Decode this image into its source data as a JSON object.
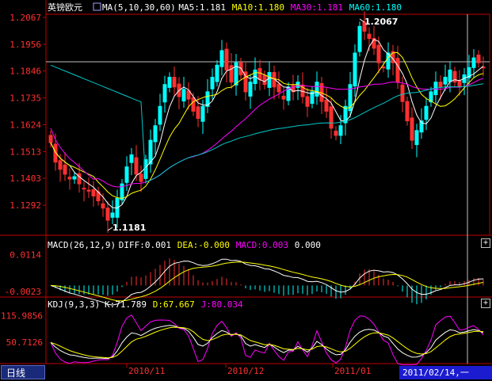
{
  "main_panel": {
    "symbol": "英镑欧元",
    "ma_label": "MA(5,10,30,60)",
    "ma_values": [
      {
        "text": "MA5:1.181",
        "color": "#ffffff"
      },
      {
        "text": "MA10:1.180",
        "color": "#ffff00"
      },
      {
        "text": "MA30:1.181",
        "color": "#ff00ff"
      },
      {
        "text": "MA60:1.180",
        "color": "#00ffff"
      }
    ],
    "y_ticks": [
      "1.2067",
      "1.1956",
      "1.1846",
      "1.1735",
      "1.1624",
      "1.1513",
      "1.1403",
      "1.1292"
    ],
    "high_label": "1.2067",
    "low_label": "1.1181"
  },
  "macd_panel": {
    "label": "MACD(26,12,9)",
    "values": [
      {
        "text": "DIFF:0.001",
        "color": "#ffffff"
      },
      {
        "text": "DEA:-0.000",
        "color": "#ffff00"
      },
      {
        "text": "MACD:0.003",
        "color": "#ff00ff"
      },
      {
        "text": "0.000",
        "color": "#ffffff"
      }
    ],
    "y_ticks": [
      "0.0114",
      "-0.0023"
    ]
  },
  "kdj_panel": {
    "label": "KDJ(9,3,3)",
    "values": [
      {
        "text": "K:71.789",
        "color": "#ffffff"
      },
      {
        "text": "D:67.667",
        "color": "#ffff00"
      },
      {
        "text": "J:80.034",
        "color": "#ff00ff"
      }
    ],
    "y_ticks": [
      "115.9856",
      "50.7126"
    ]
  },
  "x_axis": {
    "months": [
      "2010/11",
      "2010/12",
      "2011/01"
    ]
  },
  "period_tab": "日线",
  "cursor_date": "2011/02/14,一",
  "plus_symbol": "+",
  "colors": {
    "up": "#00ffff",
    "down": "#ff3030",
    "axis": "#c00000",
    "ma5": "#ffffff",
    "ma10": "#ffff00",
    "ma30": "#ff00ff",
    "ma60": "#00c8c8",
    "tick_text": "#ff3030"
  },
  "chart_data": {
    "type": "candlestick",
    "ylim": [
      1.1181,
      1.2067
    ],
    "close_series": [
      1.155,
      1.147,
      1.144,
      1.142,
      1.14,
      1.141,
      1.138,
      1.136,
      1.135,
      1.133,
      1.131,
      1.128,
      1.123,
      1.126,
      1.132,
      1.138,
      1.145,
      1.15,
      1.142,
      1.139,
      1.148,
      1.156,
      1.162,
      1.17,
      1.179,
      1.182,
      1.178,
      1.174,
      1.177,
      1.173,
      1.168,
      1.165,
      1.17,
      1.176,
      1.182,
      1.187,
      1.193,
      1.185,
      1.18,
      1.188,
      1.183,
      1.176,
      1.18,
      1.185,
      1.181,
      1.179,
      1.184,
      1.178,
      1.176,
      1.173,
      1.178,
      1.176,
      1.18,
      1.174,
      1.17,
      1.176,
      1.18,
      1.172,
      1.168,
      1.161,
      1.158,
      1.162,
      1.17,
      1.179,
      1.192,
      1.203,
      1.201,
      1.198,
      1.194,
      1.188,
      1.186,
      1.192,
      1.188,
      1.18,
      1.172,
      1.164,
      1.156,
      1.16,
      1.164,
      1.17,
      1.176,
      1.18,
      1.178,
      1.182,
      1.185,
      1.18,
      1.178,
      1.183,
      1.186,
      1.19,
      1.188,
      1.186
    ],
    "macd_ylim": [
      -0.004,
      0.013
    ],
    "kdj_ylim": [
      0,
      125
    ]
  }
}
